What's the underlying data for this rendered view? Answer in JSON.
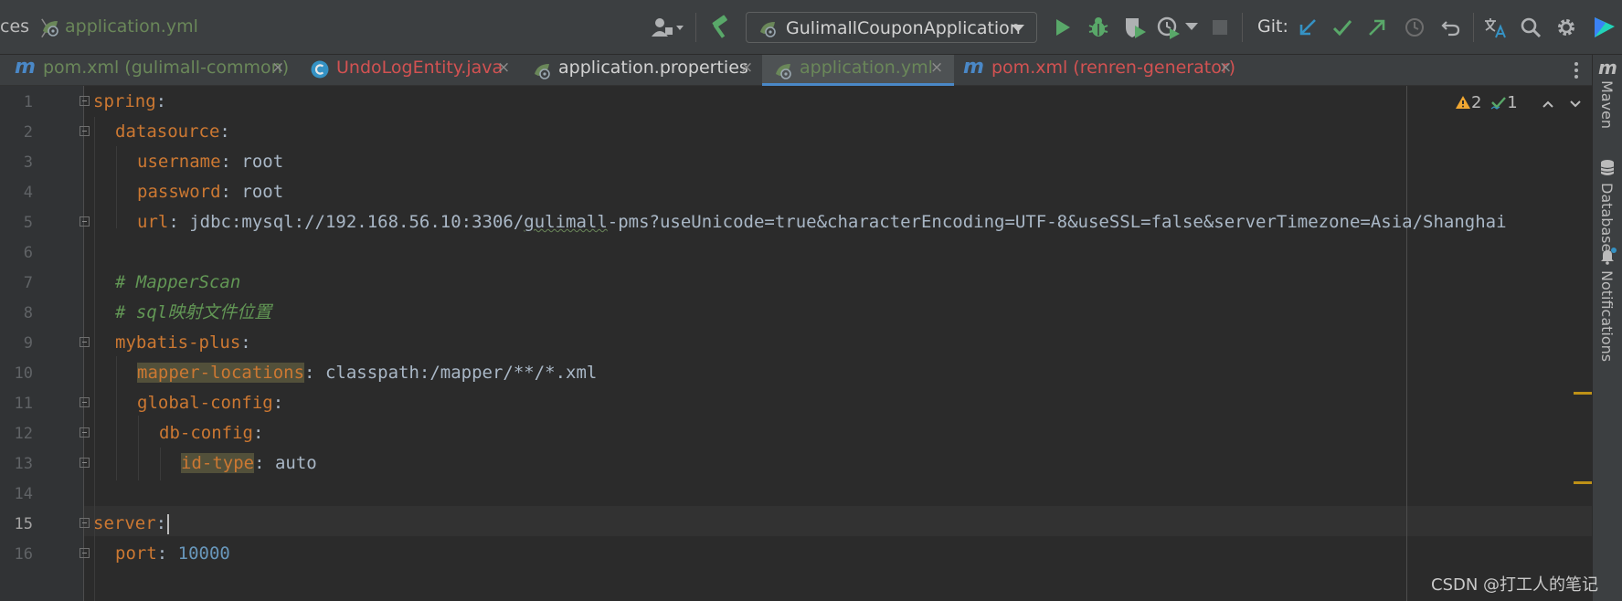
{
  "breadcrumb": {
    "prefix": "ces",
    "file": "application.yml"
  },
  "toolbar": {
    "run_config": "GulimallCouponApplication",
    "git_label": "Git:"
  },
  "tabs": [
    {
      "label": "pom.xml (gulimall-common)",
      "color": "#6a8759",
      "icon": "maven-icon",
      "active": false
    },
    {
      "label": "UndoLogEntity.java",
      "color": "#d25252",
      "icon": "java-class-icon",
      "active": false
    },
    {
      "label": "application.properties",
      "color": "#d2d2d2",
      "icon": "spring-config-icon",
      "active": false
    },
    {
      "label": "application.yml",
      "color": "#6a8759",
      "icon": "spring-config-icon",
      "active": true
    },
    {
      "label": "pom.xml (renren-generator)",
      "color": "#d25252",
      "icon": "maven-icon",
      "active": false
    }
  ],
  "tab_close_glyph": "×",
  "inspections": {
    "warnings": "2",
    "weak_warnings": "1"
  },
  "line_numbers": [
    "1",
    "2",
    "3",
    "4",
    "5",
    "6",
    "7",
    "8",
    "9",
    "10",
    "11",
    "12",
    "13",
    "14",
    "15",
    "16"
  ],
  "current_line": "15",
  "code": {
    "l1_key": "spring",
    "l2_key": "datasource",
    "l3_key": "username",
    "l3_val": "root",
    "l4_key": "password",
    "l4_val": "root",
    "l5_key": "url",
    "l5_val_a": "jdbc:mysql://192.168.56.10:3306/",
    "l5_val_b": "gulimall",
    "l5_val_c": "-pms?useUnicode=true&characterEncoding=UTF-8&useSSL=false&serverTimezone=Asia/Shanghai",
    "l7_cmt": "# MapperScan",
    "l8_cmt": "# sql映射文件位置",
    "l9_key": "mybatis-plus",
    "l10_key": "mapper-locations",
    "l10_val": "classpath:/mapper/**/*.xml",
    "l11_key": "global-config",
    "l12_key": "db-config",
    "l13_key": "id-type",
    "l13_val": "auto",
    "l15_key": "server",
    "l16_key": "port",
    "l16_val": "10000",
    "colon": ":"
  },
  "sidebar": {
    "maven": "Maven",
    "database": "Database",
    "notifications": "Notifications"
  },
  "watermark": "CSDN @打工人的笔记"
}
